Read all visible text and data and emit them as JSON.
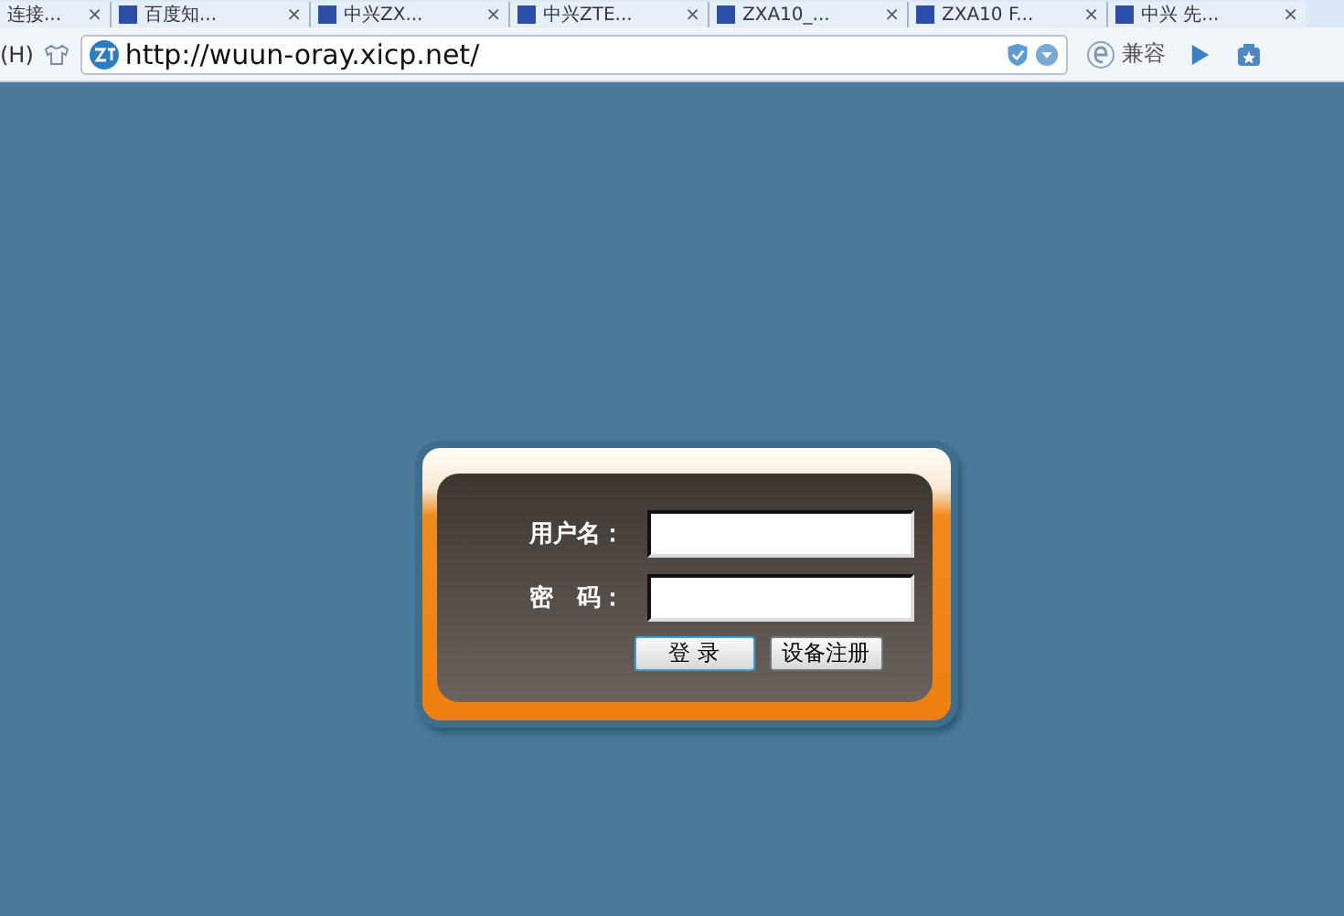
{
  "tabs": [
    {
      "label": "连接...",
      "selected": false
    },
    {
      "label": "百度知...",
      "selected": false
    },
    {
      "label": "中兴ZX...",
      "selected": false
    },
    {
      "label": "中兴ZTE...",
      "selected": false
    },
    {
      "label": "ZXA10_...",
      "selected": false
    },
    {
      "label": "ZXA10 F...",
      "selected": false
    },
    {
      "label": "中兴 先...",
      "selected": false
    }
  ],
  "tab_close": "×",
  "toolbar": {
    "menu_fragment": "(H)",
    "address": "http://wuun-oray.xicp.net/",
    "compat_button": "兼容"
  },
  "login": {
    "username_label": "用户名：",
    "password_label": "密　码：",
    "login_button": "登 录",
    "register_button": "设备注册"
  }
}
